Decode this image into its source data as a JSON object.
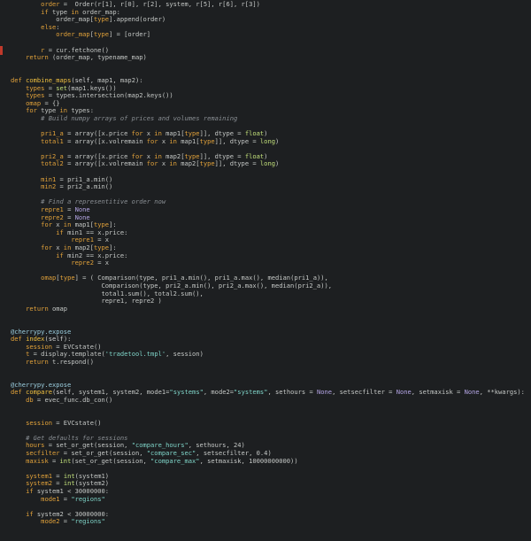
{
  "editor": {
    "lines": [
      [
        [
          "op",
          "        "
        ],
        [
          "kw",
          "order"
        ],
        [
          "op",
          " =  Order(r[1], r[0], r[2], system, r[5], r[6], r[3])"
        ]
      ],
      [
        [
          "op",
          "        "
        ],
        [
          "kw",
          "if"
        ],
        [
          "op",
          " type "
        ],
        [
          "kw",
          "in"
        ],
        [
          "op",
          " order_map:"
        ]
      ],
      [
        [
          "op",
          "            order_map["
        ],
        [
          "kw",
          "type"
        ],
        [
          "op",
          "].append(order)"
        ]
      ],
      [
        [
          "op",
          "        "
        ],
        [
          "kw",
          "else"
        ],
        [
          "op",
          ":"
        ]
      ],
      [
        [
          "op",
          "            "
        ],
        [
          "kw",
          "order_map"
        ],
        [
          "op",
          "["
        ],
        [
          "kw",
          "type"
        ],
        [
          "op",
          "] = [order]"
        ]
      ],
      [
        [
          "op",
          ""
        ]
      ],
      [
        [
          "op",
          "        "
        ],
        [
          "kw",
          "r"
        ],
        [
          "op",
          " = cur.fetchone()"
        ]
      ],
      [
        [
          "op",
          "    "
        ],
        [
          "kw",
          "return"
        ],
        [
          "op",
          " (order_map, typename_map)"
        ]
      ],
      [
        [
          "op",
          ""
        ]
      ],
      [
        [
          "op",
          ""
        ]
      ],
      [
        [
          "kw",
          "def"
        ],
        [
          "op",
          " "
        ],
        [
          "fn",
          "combine_maps"
        ],
        [
          "op",
          "("
        ],
        [
          "slf",
          "self"
        ],
        [
          "op",
          ", map1, map2):"
        ]
      ],
      [
        [
          "op",
          "    "
        ],
        [
          "kw",
          "types"
        ],
        [
          "op",
          " = "
        ],
        [
          "bi",
          "set"
        ],
        [
          "op",
          "(map1.keys())"
        ]
      ],
      [
        [
          "op",
          "    "
        ],
        [
          "kw",
          "types"
        ],
        [
          "op",
          " = types.intersection(map2.keys())"
        ]
      ],
      [
        [
          "op",
          "    "
        ],
        [
          "kw",
          "omap"
        ],
        [
          "op",
          " = {}"
        ]
      ],
      [
        [
          "op",
          "    "
        ],
        [
          "kw",
          "for"
        ],
        [
          "op",
          " type "
        ],
        [
          "kw",
          "in"
        ],
        [
          "op",
          " types:"
        ]
      ],
      [
        [
          "op",
          "        "
        ],
        [
          "cm",
          "# Build numpy arrays of prices and volumes remaining"
        ]
      ],
      [
        [
          "op",
          ""
        ]
      ],
      [
        [
          "op",
          "        "
        ],
        [
          "kw",
          "pri1_a"
        ],
        [
          "op",
          " = array([x.price "
        ],
        [
          "kw",
          "for"
        ],
        [
          "op",
          " x "
        ],
        [
          "kw",
          "in"
        ],
        [
          "op",
          " map1["
        ],
        [
          "kw",
          "type"
        ],
        [
          "op",
          "]], dtype = "
        ],
        [
          "bi",
          "float"
        ],
        [
          "op",
          ")"
        ]
      ],
      [
        [
          "op",
          "        "
        ],
        [
          "kw",
          "total1"
        ],
        [
          "op",
          " = array([x.volremain "
        ],
        [
          "kw",
          "for"
        ],
        [
          "op",
          " x "
        ],
        [
          "kw",
          "in"
        ],
        [
          "op",
          " map1["
        ],
        [
          "kw",
          "type"
        ],
        [
          "op",
          "]], dtype = "
        ],
        [
          "bi",
          "long"
        ],
        [
          "op",
          ")"
        ]
      ],
      [
        [
          "op",
          ""
        ]
      ],
      [
        [
          "op",
          "        "
        ],
        [
          "kw",
          "pri2_a"
        ],
        [
          "op",
          " = array([x.price "
        ],
        [
          "kw",
          "for"
        ],
        [
          "op",
          " x "
        ],
        [
          "kw",
          "in"
        ],
        [
          "op",
          " map2["
        ],
        [
          "kw",
          "type"
        ],
        [
          "op",
          "]], dtype = "
        ],
        [
          "bi",
          "float"
        ],
        [
          "op",
          ")"
        ]
      ],
      [
        [
          "op",
          "        "
        ],
        [
          "kw",
          "total2"
        ],
        [
          "op",
          " = array([x.volremain "
        ],
        [
          "kw",
          "for"
        ],
        [
          "op",
          " x "
        ],
        [
          "kw",
          "in"
        ],
        [
          "op",
          " map2["
        ],
        [
          "kw",
          "type"
        ],
        [
          "op",
          "]], dtype = "
        ],
        [
          "bi",
          "long"
        ],
        [
          "op",
          ")"
        ]
      ],
      [
        [
          "op",
          ""
        ]
      ],
      [
        [
          "op",
          "        "
        ],
        [
          "kw",
          "min1"
        ],
        [
          "op",
          " = pri1_a.min()"
        ]
      ],
      [
        [
          "op",
          "        "
        ],
        [
          "kw",
          "min2"
        ],
        [
          "op",
          " = pri2_a.min()"
        ]
      ],
      [
        [
          "op",
          ""
        ]
      ],
      [
        [
          "op",
          "        "
        ],
        [
          "cm",
          "# Find a representitive order now"
        ]
      ],
      [
        [
          "op",
          "        "
        ],
        [
          "kw",
          "repre1"
        ],
        [
          "op",
          " = "
        ],
        [
          "num",
          "None"
        ]
      ],
      [
        [
          "op",
          "        "
        ],
        [
          "kw",
          "repre2"
        ],
        [
          "op",
          " = "
        ],
        [
          "num",
          "None"
        ]
      ],
      [
        [
          "op",
          "        "
        ],
        [
          "kw",
          "for"
        ],
        [
          "op",
          " x "
        ],
        [
          "kw",
          "in"
        ],
        [
          "op",
          " map1["
        ],
        [
          "kw",
          "type"
        ],
        [
          "op",
          "]:"
        ]
      ],
      [
        [
          "op",
          "            "
        ],
        [
          "kw",
          "if"
        ],
        [
          "op",
          " min1 == x.price:"
        ]
      ],
      [
        [
          "op",
          "                "
        ],
        [
          "kw",
          "repre1"
        ],
        [
          "op",
          " = x"
        ]
      ],
      [
        [
          "op",
          "        "
        ],
        [
          "kw",
          "for"
        ],
        [
          "op",
          " x "
        ],
        [
          "kw",
          "in"
        ],
        [
          "op",
          " map2["
        ],
        [
          "kw",
          "type"
        ],
        [
          "op",
          "]:"
        ]
      ],
      [
        [
          "op",
          "            "
        ],
        [
          "kw",
          "if"
        ],
        [
          "op",
          " min2 == x.price:"
        ]
      ],
      [
        [
          "op",
          "                "
        ],
        [
          "kw",
          "repre2"
        ],
        [
          "op",
          " = x"
        ]
      ],
      [
        [
          "op",
          ""
        ]
      ],
      [
        [
          "op",
          "        "
        ],
        [
          "kw",
          "omap"
        ],
        [
          "op",
          "["
        ],
        [
          "kw",
          "type"
        ],
        [
          "op",
          "] = ( Comparison(type, pri1_a.min(), pri1_a.max(), median(pri1_a)),"
        ]
      ],
      [
        [
          "op",
          "                        Comparison(type, pri2_a.min(), pri2_a.max(), median(pri2_a)),"
        ]
      ],
      [
        [
          "op",
          "                        total1.sum(), total2.sum(),"
        ]
      ],
      [
        [
          "op",
          "                        repre1, repre2 )"
        ]
      ],
      [
        [
          "op",
          "    "
        ],
        [
          "kw",
          "return"
        ],
        [
          "op",
          " omap"
        ]
      ],
      [
        [
          "op",
          ""
        ]
      ],
      [
        [
          "op",
          ""
        ]
      ],
      [
        [
          "dec",
          "@cherrypy.expose"
        ]
      ],
      [
        [
          "kw",
          "def"
        ],
        [
          "op",
          " "
        ],
        [
          "fn",
          "index"
        ],
        [
          "op",
          "("
        ],
        [
          "slf",
          "self"
        ],
        [
          "op",
          "):"
        ]
      ],
      [
        [
          "op",
          "    "
        ],
        [
          "kw",
          "session"
        ],
        [
          "op",
          " = EVCstate()"
        ]
      ],
      [
        [
          "op",
          "    "
        ],
        [
          "kw",
          "t"
        ],
        [
          "op",
          " = display.template("
        ],
        [
          "str",
          "'tradetool.tmpl'"
        ],
        [
          "op",
          ", session)"
        ]
      ],
      [
        [
          "op",
          "    "
        ],
        [
          "kw",
          "return"
        ],
        [
          "op",
          " t.respond()"
        ]
      ],
      [
        [
          "op",
          ""
        ]
      ],
      [
        [
          "op",
          ""
        ]
      ],
      [
        [
          "dec",
          "@cherrypy.expose"
        ]
      ],
      [
        [
          "kw",
          "def"
        ],
        [
          "op",
          " "
        ],
        [
          "fn",
          "compare"
        ],
        [
          "op",
          "("
        ],
        [
          "slf",
          "self"
        ],
        [
          "op",
          ", system1, system2, mode1="
        ],
        [
          "str",
          "\"systems\""
        ],
        [
          "op",
          ", mode2="
        ],
        [
          "str",
          "\"systems\""
        ],
        [
          "op",
          ", sethours = "
        ],
        [
          "num",
          "None"
        ],
        [
          "op",
          ", setsecfilter = "
        ],
        [
          "num",
          "None"
        ],
        [
          "op",
          ", setmaxisk = "
        ],
        [
          "num",
          "None"
        ],
        [
          "op",
          ", **kwargs):"
        ]
      ],
      [
        [
          "op",
          "    "
        ],
        [
          "kw",
          "db"
        ],
        [
          "op",
          " = evec_func.db_con()"
        ]
      ],
      [
        [
          "op",
          ""
        ]
      ],
      [
        [
          "op",
          ""
        ]
      ],
      [
        [
          "op",
          "    "
        ],
        [
          "kw",
          "session"
        ],
        [
          "op",
          " = EVCstate()"
        ]
      ],
      [
        [
          "op",
          ""
        ]
      ],
      [
        [
          "op",
          "    "
        ],
        [
          "cm",
          "# Get defaults for sessions"
        ]
      ],
      [
        [
          "op",
          "    "
        ],
        [
          "kw",
          "hours"
        ],
        [
          "op",
          " = set_or_get(session, "
        ],
        [
          "str",
          "\"compare_hours\""
        ],
        [
          "op",
          ", sethours, 24)"
        ]
      ],
      [
        [
          "op",
          "    "
        ],
        [
          "kw",
          "secfilter"
        ],
        [
          "op",
          " = set_or_get(session, "
        ],
        [
          "str",
          "\"compare_sec\""
        ],
        [
          "op",
          ", setsecfilter, 0.4)"
        ]
      ],
      [
        [
          "op",
          "    "
        ],
        [
          "kw",
          "maxisk"
        ],
        [
          "op",
          " = "
        ],
        [
          "bi",
          "int"
        ],
        [
          "op",
          "(set_or_get(session, "
        ],
        [
          "str",
          "\"compare_max\""
        ],
        [
          "op",
          ", setmaxisk, 10000000000))"
        ]
      ],
      [
        [
          "op",
          ""
        ]
      ],
      [
        [
          "op",
          "    "
        ],
        [
          "kw",
          "system1"
        ],
        [
          "op",
          " = "
        ],
        [
          "bi",
          "int"
        ],
        [
          "op",
          "(system1)"
        ]
      ],
      [
        [
          "op",
          "    "
        ],
        [
          "kw",
          "system2"
        ],
        [
          "op",
          " = "
        ],
        [
          "bi",
          "int"
        ],
        [
          "op",
          "(system2)"
        ]
      ],
      [
        [
          "op",
          "    "
        ],
        [
          "kw",
          "if"
        ],
        [
          "op",
          " system1 < 30000000:"
        ]
      ],
      [
        [
          "op",
          "        "
        ],
        [
          "kw",
          "mode1"
        ],
        [
          "op",
          " = "
        ],
        [
          "str",
          "\"regions\""
        ]
      ],
      [
        [
          "op",
          ""
        ]
      ],
      [
        [
          "op",
          "    "
        ],
        [
          "kw",
          "if"
        ],
        [
          "op",
          " system2 < 30000000:"
        ]
      ],
      [
        [
          "op",
          "        "
        ],
        [
          "kw",
          "mode2"
        ],
        [
          "op",
          " = "
        ],
        [
          "str",
          "\"regions\""
        ]
      ],
      [
        [
          "op",
          ""
        ]
      ],
      [
        [
          "op",
          ""
        ]
      ]
    ]
  }
}
